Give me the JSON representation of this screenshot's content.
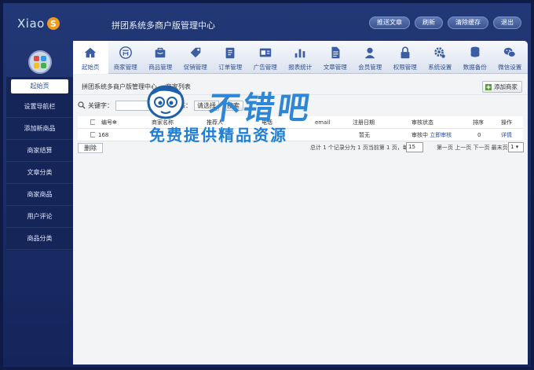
{
  "header": {
    "logo_text": "Xiao",
    "logo_letter": "S",
    "title": "拼团系统多商户版管理中心",
    "buttons": [
      "推送文章",
      "刷新",
      "清除缓存",
      "退出"
    ]
  },
  "sidebar": {
    "items": [
      {
        "label": "起始页",
        "active": true
      },
      {
        "label": "设置导航栏"
      },
      {
        "label": "添加新商品"
      },
      {
        "label": "商家结算"
      },
      {
        "label": "文章分类"
      },
      {
        "label": "商家商品"
      },
      {
        "label": "用户评论"
      },
      {
        "label": "商品分类"
      }
    ]
  },
  "tabs": [
    {
      "label": "起始页",
      "icon": "home-icon",
      "active": true
    },
    {
      "label": "商家管理",
      "icon": "merchant-icon"
    },
    {
      "label": "商品管理",
      "icon": "product-icon"
    },
    {
      "label": "促销管理",
      "icon": "promotion-icon"
    },
    {
      "label": "订单管理",
      "icon": "order-icon"
    },
    {
      "label": "广告管理",
      "icon": "ad-icon"
    },
    {
      "label": "报表统计",
      "icon": "report-icon"
    },
    {
      "label": "文章管理",
      "icon": "article-icon"
    },
    {
      "label": "会员管理",
      "icon": "member-icon"
    },
    {
      "label": "权限管理",
      "icon": "lock-icon"
    },
    {
      "label": "系统设置",
      "icon": "gear-icon"
    },
    {
      "label": "数据备份",
      "icon": "database-icon"
    },
    {
      "label": "微信设置",
      "icon": "wechat-icon"
    }
  ],
  "breadcrumb": {
    "root": "拼团系统多商户版管理中心",
    "current": "商家列表"
  },
  "add_button": "添加商家",
  "search": {
    "keyword_label": "关键字：",
    "status_label": "审核状态：",
    "status_selected": "请选择",
    "search_button": "搜索"
  },
  "table": {
    "headers": [
      "编号",
      "商家名称",
      "推荐人",
      "电话",
      "email",
      "注册日期",
      "审核状态",
      "排序",
      "操作"
    ],
    "rows": [
      {
        "id": "168",
        "name": "",
        "referrer": "",
        "phone": "",
        "email": "",
        "date": "暂无",
        "status": "审核中",
        "status_link": "立即审核",
        "sort": "0",
        "action": "详情"
      }
    ]
  },
  "pager": {
    "delete_button": "删除",
    "info": "总计 1 个记录分为 1 页当前第 1 页，每页",
    "page_size": "15",
    "links": "第一页 上一页 下一页 最末页",
    "current_page": "1"
  },
  "watermark": {
    "brand": "不错吧",
    "slogan": "免费提供精品资源"
  }
}
